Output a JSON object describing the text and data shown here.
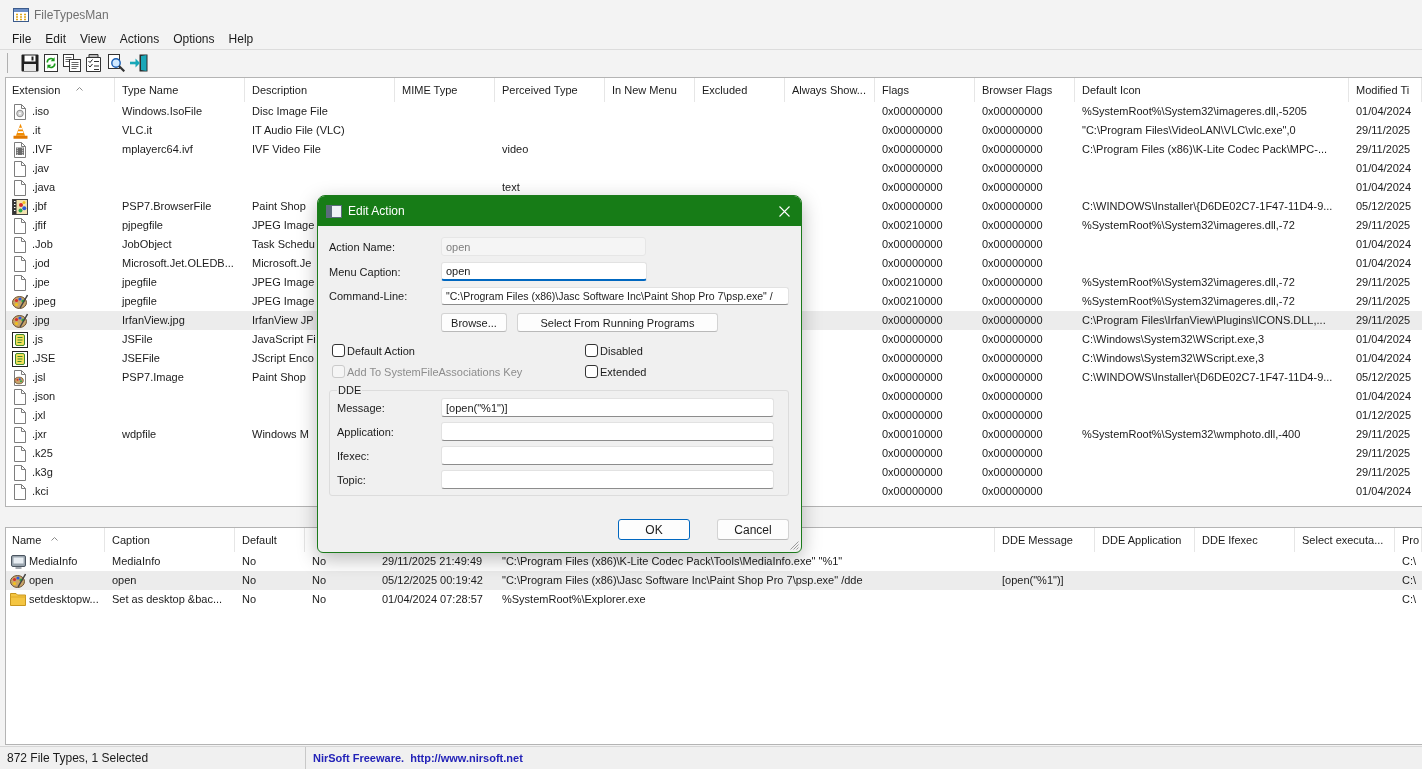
{
  "window": {
    "title": "FileTypesMan"
  },
  "menu": [
    "File",
    "Edit",
    "View",
    "Actions",
    "Options",
    "Help"
  ],
  "file_types_table": {
    "columns": [
      {
        "label": "Extension",
        "sorted": true
      },
      {
        "label": "Type Name",
        "sorted": false
      },
      {
        "label": "Description",
        "sorted": false
      },
      {
        "label": "MIME Type",
        "sorted": false
      },
      {
        "label": "Perceived Type",
        "sorted": false
      },
      {
        "label": "In New Menu",
        "sorted": false
      },
      {
        "label": "Excluded",
        "sorted": false
      },
      {
        "label": "Always Show...",
        "sorted": false
      },
      {
        "label": "Flags",
        "sorted": false
      },
      {
        "label": "Browser Flags",
        "sorted": false
      },
      {
        "label": "Default Icon",
        "sorted": false
      },
      {
        "label": "Modified Ti",
        "sorted": false
      }
    ],
    "rows": [
      {
        "kind": "disc",
        "selected": false,
        "extension": ".iso",
        "type_name": "Windows.IsoFile",
        "description": "Disc Image File",
        "flags": "0x00000000",
        "browser_flags": "0x00000000",
        "default_icon": "%SystemRoot%\\System32\\imageres.dll,-5205",
        "column_12": "01/04/2024"
      },
      {
        "kind": "cone",
        "selected": false,
        "extension": ".it",
        "type_name": "VLC.it",
        "description": "IT Audio File (VLC)",
        "flags": "0x00000000",
        "browser_flags": "0x00000000",
        "default_icon": "\"C:\\Program Files\\VideoLAN\\VLC\\vlc.exe\",0",
        "column_12": "29/11/2025"
      },
      {
        "kind": "video",
        "selected": false,
        "extension": ".IVF",
        "type_name": "mplayerc64.ivf",
        "description": "IVF Video File",
        "perceived_type": "video",
        "flags": "0x00000000",
        "browser_flags": "0x00000000",
        "default_icon": "C:\\Program Files (x86)\\K-Lite Codec Pack\\MPC-...",
        "column_12": "29/11/2025"
      },
      {
        "kind": "blank",
        "selected": false,
        "extension": ".jav",
        "flags": "0x00000000",
        "browser_flags": "0x00000000",
        "column_12": "01/04/2024"
      },
      {
        "kind": "blank",
        "selected": false,
        "extension": ".java",
        "perceived_type": "text",
        "flags": "0x00000000",
        "browser_flags": "0x00000000",
        "column_12": "01/04/2024"
      },
      {
        "kind": "paint-film",
        "selected": false,
        "extension": ".jbf",
        "type_name": "PSP7.BrowserFile",
        "description": "Paint Shop",
        "flags": "0x00000000",
        "browser_flags": "0x00000000",
        "default_icon": "C:\\WINDOWS\\Installer\\{D6DE02C7-1F47-11D4-9...",
        "column_12": "05/12/2025"
      },
      {
        "kind": "blank",
        "selected": false,
        "extension": ".jfif",
        "type_name": "pjpegfile",
        "description": "JPEG Image",
        "flags": "0x00210000",
        "browser_flags": "0x00000000",
        "default_icon": "%SystemRoot%\\System32\\imageres.dll,-72",
        "column_12": "29/11/2025"
      },
      {
        "kind": "blank",
        "selected": false,
        "extension": ".Job",
        "type_name": "JobObject",
        "description": "Task Schedu",
        "flags": "0x00000000",
        "browser_flags": "0x00000000",
        "column_12": "01/04/2024"
      },
      {
        "kind": "blank",
        "selected": false,
        "extension": ".jod",
        "type_name": "Microsoft.Jet.OLEDB...",
        "description": "Microsoft.Je",
        "flags": "0x00000000",
        "browser_flags": "0x00000000",
        "column_12": "01/04/2024"
      },
      {
        "kind": "blank",
        "selected": false,
        "extension": ".jpe",
        "type_name": "jpegfile",
        "description": "JPEG Image",
        "flags": "0x00210000",
        "browser_flags": "0x00000000",
        "default_icon": "%SystemRoot%\\System32\\imageres.dll,-72",
        "column_12": "29/11/2025"
      },
      {
        "kind": "palette",
        "selected": false,
        "extension": ".jpeg",
        "type_name": "jpegfile",
        "description": "JPEG Image",
        "flags": "0x00210000",
        "browser_flags": "0x00000000",
        "default_icon": "%SystemRoot%\\System32\\imageres.dll,-72",
        "column_12": "29/11/2025"
      },
      {
        "kind": "palette",
        "selected": true,
        "extension": ".jpg",
        "type_name": "IrfanView.jpg",
        "description": "IrfanView JP",
        "flags": "0x00000000",
        "browser_flags": "0x00000000",
        "default_icon": "C:\\Program Files\\IrfanView\\Plugins\\ICONS.DLL,...",
        "column_12": "29/11/2025"
      },
      {
        "kind": "script",
        "selected": false,
        "extension": ".js",
        "type_name": "JSFile",
        "description": "JavaScript Fi",
        "flags": "0x00000000",
        "browser_flags": "0x00000000",
        "default_icon": "C:\\Windows\\System32\\WScript.exe,3",
        "column_12": "01/04/2024"
      },
      {
        "kind": "script",
        "selected": false,
        "extension": ".JSE",
        "type_name": "JSEFile",
        "description": "JScript Enco",
        "flags": "0x00000000",
        "browser_flags": "0x00000000",
        "default_icon": "C:\\Windows\\System32\\WScript.exe,3",
        "column_12": "01/04/2024"
      },
      {
        "kind": "paint-page",
        "selected": false,
        "extension": ".jsl",
        "type_name": "PSP7.Image",
        "description": "Paint Shop",
        "flags": "0x00000000",
        "browser_flags": "0x00000000",
        "default_icon": "C:\\WINDOWS\\Installer\\{D6DE02C7-1F47-11D4-9...",
        "column_12": "05/12/2025"
      },
      {
        "kind": "blank",
        "selected": false,
        "extension": ".json",
        "flags": "0x00000000",
        "browser_flags": "0x00000000",
        "column_12": "01/04/2024"
      },
      {
        "kind": "blank",
        "selected": false,
        "extension": ".jxl",
        "flags": "0x00000000",
        "browser_flags": "0x00000000",
        "column_12": "01/12/2025"
      },
      {
        "kind": "blank",
        "selected": false,
        "extension": ".jxr",
        "type_name": "wdpfile",
        "description": "Windows M",
        "flags": "0x00010000",
        "browser_flags": "0x00000000",
        "default_icon": "%SystemRoot%\\System32\\wmphoto.dll,-400",
        "column_12": "29/11/2025"
      },
      {
        "kind": "blank",
        "selected": false,
        "extension": ".k25",
        "flags": "0x00000000",
        "browser_flags": "0x00000000",
        "column_12": "29/11/2025"
      },
      {
        "kind": "blank",
        "selected": false,
        "extension": ".k3g",
        "flags": "0x00000000",
        "browser_flags": "0x00000000",
        "column_12": "29/11/2025"
      },
      {
        "kind": "blank",
        "selected": false,
        "extension": ".kci",
        "flags": "0x00000000",
        "browser_flags": "0x00000000",
        "column_12": "01/04/2024"
      }
    ]
  },
  "actions_table": {
    "columns": [
      {
        "label": "Name",
        "sorted": true
      },
      {
        "label": "Caption",
        "sorted": false
      },
      {
        "label": "Default",
        "sorted": false
      },
      null,
      null,
      null,
      {
        "label": "DDE Message",
        "sorted": false
      },
      {
        "label": "DDE Application",
        "sorted": false
      },
      {
        "label": "DDE Ifexec",
        "sorted": false
      },
      {
        "label": "Select executa...",
        "sorted": false
      },
      {
        "label": "Pro",
        "sorted": false
      }
    ],
    "rows": [
      {
        "kind": "media",
        "selected": false,
        "name": "MediaInfo",
        "caption": "MediaInfo",
        "default": "No",
        "column_4": "No",
        "column_5": "29/11/2025 21:49:49",
        "column_6": "\"C:\\Program Files (x86)\\K-Lite Codec Pack\\Tools\\MediaInfo.exe\" \"%1\"",
        "column_11": "C:\\"
      },
      {
        "kind": "palette",
        "selected": true,
        "name": "open",
        "caption": "open",
        "default": "No",
        "column_4": "No",
        "column_5": "05/12/2025 00:19:42",
        "column_6": "\"C:\\Program Files (x86)\\Jasc Software Inc\\Paint Shop Pro 7\\psp.exe\" /dde",
        "dde_message": "[open(\"%1\")]",
        "column_11": "C:\\"
      },
      {
        "kind": "folder",
        "selected": false,
        "name": "setdesktopw...",
        "caption": "Set as desktop &bac...",
        "default": "No",
        "column_4": "No",
        "column_5": "01/04/2024 07:28:57",
        "column_6": "%SystemRoot%\\Explorer.exe",
        "column_11": "C:\\"
      }
    ]
  },
  "edit_action_dialog": {
    "title": "Edit Action",
    "fields": [
      {
        "label": "Action Name:",
        "value": "open",
        "disabled": true,
        "focused": false
      },
      {
        "label": "Menu Caption:",
        "value": "open",
        "disabled": false,
        "focused": true
      },
      {
        "label": "Command-Line:",
        "value": "\"C:\\Program Files (x86)\\Jasc Software Inc\\Paint Shop Pro 7\\psp.exe\" /",
        "disabled": false,
        "focused": false
      }
    ],
    "command_buttons": [
      "Browse...",
      "Select From Running Programs"
    ],
    "checkboxes": [
      {
        "label": "Default Action",
        "checked": false,
        "disabled": false
      },
      {
        "label": "Disabled",
        "checked": false,
        "disabled": false
      },
      {
        "label": "Add To SystemFileAssociations Key",
        "checked": false,
        "disabled": true
      },
      {
        "label": "Extended",
        "checked": false,
        "disabled": false
      }
    ],
    "dde_group": {
      "title": "DDE",
      "fields": [
        {
          "label": "Message:",
          "value": "[open(\"%1\")]"
        },
        {
          "label": "Application:"
        },
        {
          "label": "Ifexec:"
        },
        {
          "label": "Topic:"
        }
      ]
    },
    "buttons": [
      {
        "label": "OK",
        "default": true
      },
      {
        "label": "Cancel",
        "default": false
      }
    ]
  },
  "status_bar": {
    "count": "872 File Types, 1 Selected",
    "credit": "NirSoft Freeware.  http://www.nirsoft.net"
  }
}
